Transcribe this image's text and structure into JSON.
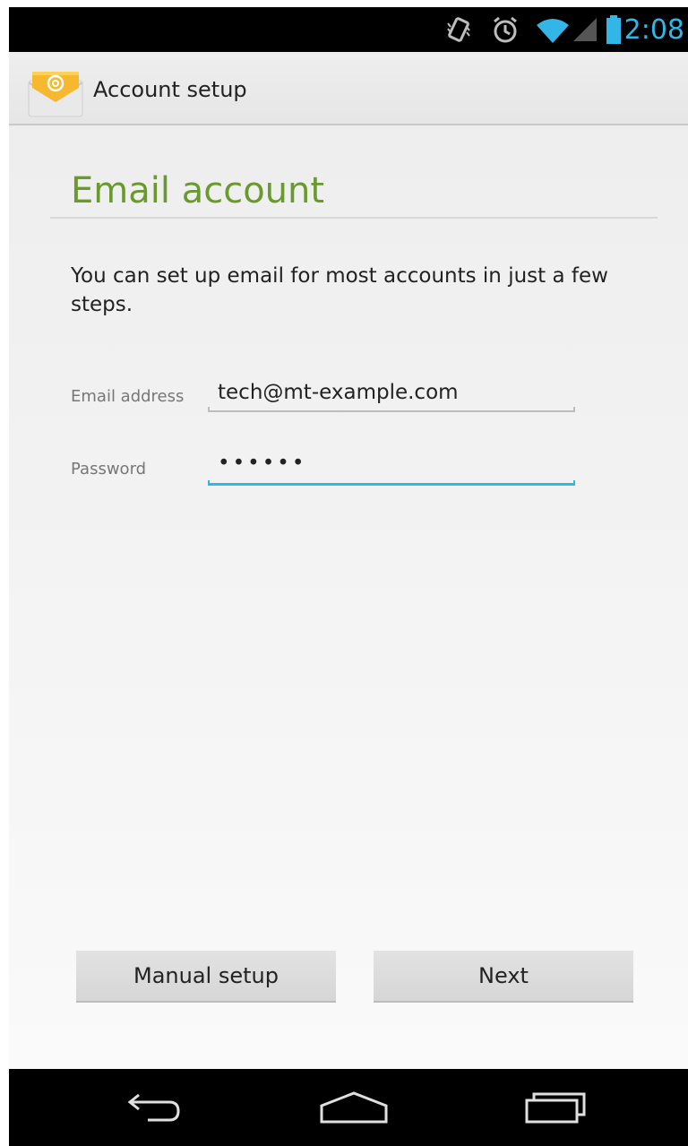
{
  "status_bar": {
    "time": "2:08",
    "icons": [
      "vibrate-icon",
      "alarm-icon",
      "wifi-icon",
      "signal-icon",
      "battery-icon"
    ],
    "accent_color": "#33b5e5"
  },
  "action_bar": {
    "title": "Account setup",
    "icon": "email-app-icon"
  },
  "main": {
    "title": "Email account",
    "title_color": "#6a9a2d",
    "intro": "You can set up email for most accounts in just a few steps.",
    "fields": {
      "email": {
        "label": "Email address",
        "value": "tech@mt-example.com"
      },
      "password": {
        "label": "Password",
        "value": "••••••"
      }
    }
  },
  "buttons": {
    "manual_setup": "Manual setup",
    "next": "Next"
  },
  "nav_bar": {
    "icons": [
      "back-icon",
      "home-icon",
      "recent-apps-icon"
    ]
  }
}
